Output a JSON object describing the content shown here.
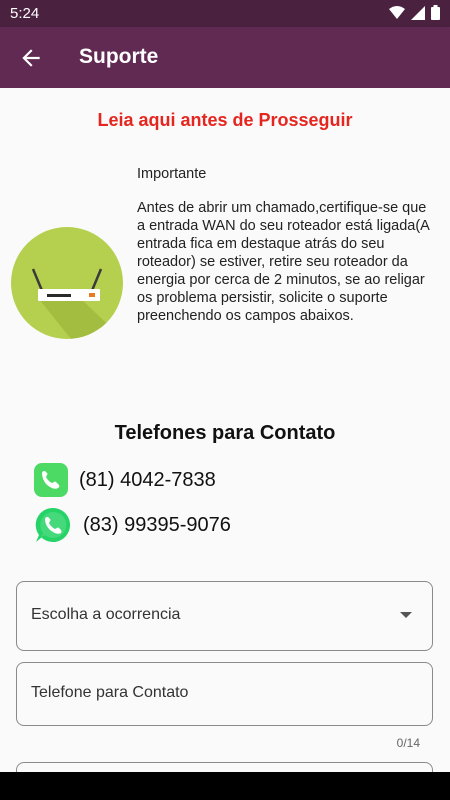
{
  "status": {
    "time": "5:24"
  },
  "appbar": {
    "title": "Suporte"
  },
  "notice": {
    "warning": "Leia aqui antes de Prosseguir"
  },
  "info": {
    "heading": "Importante",
    "body": "Antes de abrir um chamado,certifique-se que a entrada WAN do seu roteador está ligada(A entrada fica em destaque atrás do seu roteador) se estiver, retire seu roteador da energia por cerca de 2 minutos, se ao religar os problema persistir, solicite o suporte preenchendo os campos abaixos."
  },
  "contacts": {
    "title": "Telefones para Contato",
    "phone": "(81) 4042-7838",
    "whatsapp": "(83) 99395-9076"
  },
  "form": {
    "occurrence_placeholder": "Escolha a ocorrencia",
    "phone_placeholder": "Telefone para Contato",
    "phone_counter": "0/14"
  },
  "colors": {
    "appbar": "#612a53",
    "statusbar": "#4a2240",
    "warning": "#e5261f",
    "router_bg": "#b5cf4e",
    "whatsapp_green": "#25d366"
  },
  "icons": [
    "wifi-icon",
    "signal-icon",
    "battery-icon",
    "back-arrow-icon",
    "router-icon",
    "phone-icon",
    "whatsapp-icon",
    "dropdown-caret-icon"
  ]
}
